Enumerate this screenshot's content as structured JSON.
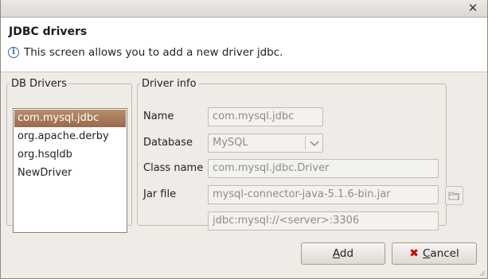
{
  "window": {
    "close_glyph": "✕"
  },
  "header": {
    "title": "JDBC drivers",
    "info_icon": "info-icon",
    "info_glyph": "i",
    "message": "This screen allows you to add a new driver jdbc."
  },
  "drivers": {
    "legend": "DB Drivers",
    "items": [
      "com.mysql.jdbc",
      "org.apache.derby",
      "org.hsqldb",
      "NewDriver"
    ],
    "selected": "com.mysql.jdbc"
  },
  "driver_info": {
    "legend": "Driver info",
    "name_label": "Name",
    "name_value": "com.mysql.jdbc",
    "database_label": "Database",
    "database_value": "MySQL",
    "classname_label": "Class name",
    "classname_value": "com.mysql.jdbc.Driver",
    "jarfile_label": "Jar file",
    "jarfile_value": "mysql-connector-java-5.1.6-bin.jar",
    "url_value": "jdbc:mysql://<server>:3306"
  },
  "buttons": {
    "add_label": "Add",
    "add_mnemonic": "A",
    "cancel_label": "Cancel",
    "cancel_mnemonic": "C",
    "cancel_icon": "cancel-x-icon"
  },
  "colors": {
    "selection": "#9a6a4b",
    "info_blue": "#3465a4",
    "cancel_red": "#cc0000",
    "disabled_text": "#8c8c8c"
  }
}
